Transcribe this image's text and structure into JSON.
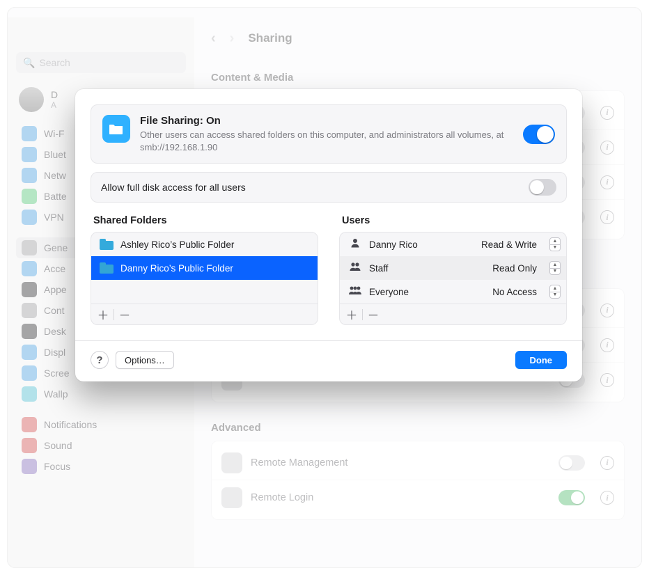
{
  "window": {
    "title": "Sharing",
    "search_placeholder": "Search"
  },
  "sidebar": {
    "user_initial": "D",
    "user_sub": "A",
    "items": [
      {
        "label": "Wi-F",
        "color": "#2fa7ff"
      },
      {
        "label": "Bluet",
        "color": "#2fa7ff"
      },
      {
        "label": "Netw",
        "color": "#2fa7ff"
      },
      {
        "label": "Batte",
        "color": "#2fd060"
      },
      {
        "label": "VPN",
        "color": "#2fa7ff"
      }
    ],
    "items2": [
      {
        "label": "Gene",
        "color": "#9d9da2",
        "selected": true
      },
      {
        "label": "Acce",
        "color": "#2fa7ff"
      },
      {
        "label": "Appe",
        "color": "#373739"
      },
      {
        "label": "Cont",
        "color": "#9d9da2"
      },
      {
        "label": "Desk",
        "color": "#373739"
      },
      {
        "label": "Displ",
        "color": "#2fa7ff"
      },
      {
        "label": "Scree",
        "color": "#2fa7ff"
      },
      {
        "label": "Wallp",
        "color": "#29c3de"
      }
    ],
    "items3": [
      {
        "label": "Notifications",
        "color": "#ff4a49"
      },
      {
        "label": "Sound",
        "color": "#ff4a49"
      },
      {
        "label": "Focus",
        "color": "#8e6ad8"
      }
    ]
  },
  "bg_main": {
    "section1_title": "Content & Media",
    "section2_title": "Advanced",
    "advanced_items": [
      {
        "label": "Remote Management",
        "on": false
      },
      {
        "label": "Remote Login",
        "on": true
      }
    ]
  },
  "modal": {
    "title": "File Sharing: On",
    "subtitle": "Other users can access shared folders on this computer, and administrators all volumes, at smb://192.168.1.90",
    "full_disk_label": "Allow full disk access for all users",
    "shared_folders_heading": "Shared Folders",
    "users_heading": "Users",
    "shared_folders": [
      {
        "label": "Ashley Rico’s Public Folder",
        "selected": false
      },
      {
        "label": "Danny Rico’s Public Folder",
        "selected": true
      }
    ],
    "users": [
      {
        "icon": "person",
        "name": "Danny Rico",
        "permission": "Read & Write",
        "alt": false
      },
      {
        "icon": "people2",
        "name": "Staff",
        "permission": "Read Only",
        "alt": true
      },
      {
        "icon": "people3",
        "name": "Everyone",
        "permission": "No Access",
        "alt": false
      }
    ],
    "options_label": "Options…",
    "done_label": "Done"
  }
}
